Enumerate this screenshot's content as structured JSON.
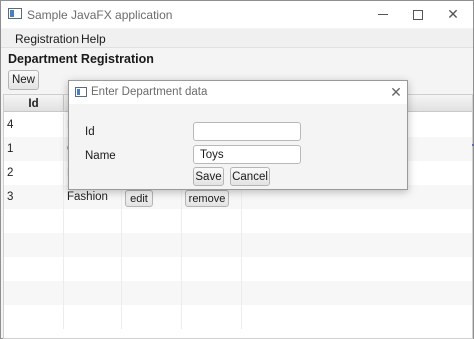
{
  "window": {
    "title": "Sample JavaFX application",
    "controls": {
      "minimize_icon": "minimize-icon",
      "maximize_icon": "maximize-icon",
      "close_glyph": "✕"
    }
  },
  "menubar": {
    "items": [
      "Registration",
      "Help"
    ]
  },
  "page": {
    "heading": "Department Registration",
    "new_label": "New"
  },
  "table": {
    "headers": [
      "Id"
    ],
    "rows": [
      {
        "id": "4",
        "name": "E",
        "edit": "",
        "remove": ""
      },
      {
        "id": "1",
        "name": "C",
        "edit": "",
        "remove": ""
      },
      {
        "id": "2",
        "name": "E",
        "edit": "",
        "remove": ""
      },
      {
        "id": "3",
        "name": "Fashion",
        "edit": "edit",
        "remove": "remove"
      }
    ]
  },
  "dialog": {
    "title": "Enter Department data",
    "close_glyph": "✕",
    "id_label": "Id",
    "name_label": "Name",
    "id_value": "",
    "name_value": "Toys",
    "save_label": "Save",
    "cancel_label": "Cancel"
  },
  "colors": {
    "accent": "#4a7fbf",
    "window_bg": "#f4f4f4",
    "titlebar_bg": "#ffffff"
  }
}
